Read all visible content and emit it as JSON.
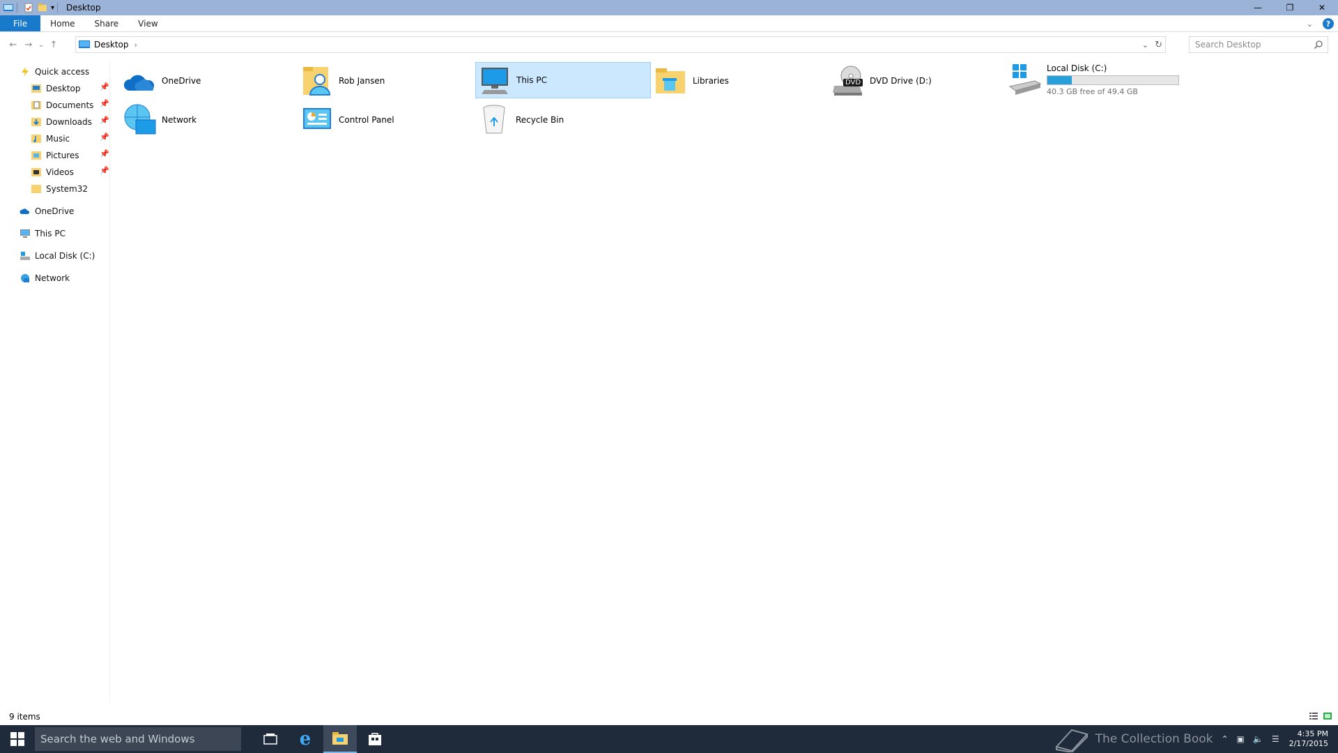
{
  "window": {
    "title": "Desktop",
    "minimize": "—",
    "restore": "❐",
    "close": "✕"
  },
  "ribbon": {
    "tabs": [
      "File",
      "Home",
      "Share",
      "View"
    ],
    "help": "?"
  },
  "address": {
    "back": "←",
    "forward": "→",
    "recent": "⌄",
    "up": "↑",
    "crumb": "Desktop",
    "chevron": "›",
    "dropdown": "⌄",
    "refresh": "↻"
  },
  "search": {
    "placeholder": "Search Desktop"
  },
  "nav": {
    "quick_access": "Quick access",
    "pinned": [
      {
        "label": "Desktop",
        "pin": "📌"
      },
      {
        "label": "Documents",
        "pin": "📌"
      },
      {
        "label": "Downloads",
        "pin": "📌"
      },
      {
        "label": "Music",
        "pin": "📌"
      },
      {
        "label": "Pictures",
        "pin": "📌"
      },
      {
        "label": "Videos",
        "pin": "📌"
      }
    ],
    "system32": "System32",
    "onedrive": "OneDrive",
    "thispc": "This PC",
    "localdisk": "Local Disk (C:)",
    "network": "Network"
  },
  "items": {
    "onedrive": "OneDrive",
    "robjansen": "Rob Jansen",
    "thispc": "This PC",
    "libraries": "Libraries",
    "dvd": "DVD Drive (D:)",
    "dvd_badge": "DVD",
    "localdisk": "Local Disk (C:)",
    "localdisk_free": "40.3 GB free of 49.4 GB",
    "localdisk_used_fraction": 0.184,
    "network": "Network",
    "controlpanel": "Control Panel",
    "recyclebin": "Recycle Bin"
  },
  "status": {
    "count": "9 items"
  },
  "taskbar": {
    "search_placeholder": "Search the web and Windows",
    "watermark": "The Collection Book",
    "time": "4:35 PM",
    "date": "2/17/2015"
  },
  "colors": {
    "accent": "#1979ca",
    "selection": "#cce8ff",
    "disk_fill": "#26a0da",
    "taskbar": "#1f2b3a"
  }
}
